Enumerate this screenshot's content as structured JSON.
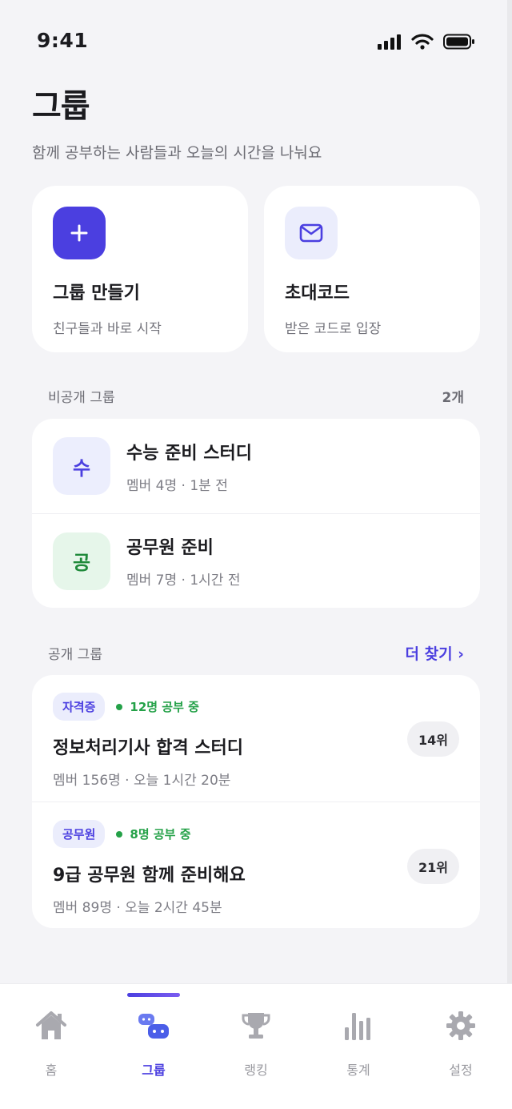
{
  "status": {
    "time": "9:41"
  },
  "header": {
    "title": "그룹",
    "subtitle": "함께 공부하는 사람들과 오늘의 시간을 나눠요"
  },
  "actions": [
    {
      "title": "그룹 만들기",
      "desc": "친구들과 바로 시작",
      "icon": "plus-icon"
    },
    {
      "title": "초대코드",
      "desc": "받은 코드로 입장",
      "icon": "mail-icon"
    }
  ],
  "private_section": {
    "label": "비공개 그룹",
    "count": "2개",
    "groups": [
      {
        "initial": "수",
        "name": "수능 준비 스터디",
        "meta": "멤버 4명 · 1분 전",
        "color": "#4b3fe0"
      },
      {
        "initial": "공",
        "name": "공무원 준비",
        "meta": "멤버 7명 · 1시간 전",
        "color": "#1f8a3a"
      }
    ]
  },
  "public_section": {
    "label": "공개 그룹",
    "more": "더 찾기 ›",
    "groups": [
      {
        "tag": "자격증",
        "live": "12명 공부 중",
        "name": "정보처리기사 합격 스터디",
        "meta": "멤버 156명 · 오늘 1시간 20분",
        "rank": "14위"
      },
      {
        "tag": "공무원",
        "live": "8명 공부 중",
        "name": "9급 공무원 함께 준비해요",
        "meta": "멤버 89명 · 오늘 2시간 45분",
        "rank": "21위"
      }
    ]
  },
  "tabs": [
    {
      "label": "홈",
      "icon": "home-icon"
    },
    {
      "label": "그룹",
      "icon": "group-icon",
      "active": true
    },
    {
      "label": "랭킹",
      "icon": "trophy-icon"
    },
    {
      "label": "통계",
      "icon": "bar-chart-icon"
    },
    {
      "label": "설정",
      "icon": "gear-icon"
    }
  ],
  "colors": {
    "accent": "#4b3fe0",
    "live": "#24a148",
    "background": "#f4f4f7"
  }
}
